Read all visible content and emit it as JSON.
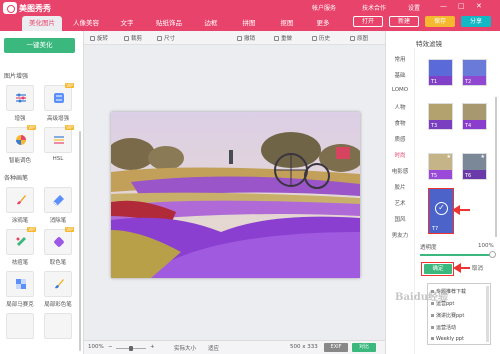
{
  "app": {
    "title": "美图秀秀"
  },
  "tabs": [
    {
      "label": "美化图片"
    },
    {
      "label": "人像美容"
    },
    {
      "label": "文字"
    },
    {
      "label": "贴纸饰品"
    },
    {
      "label": "边框"
    },
    {
      "label": "拼图"
    },
    {
      "label": "抠图"
    },
    {
      "label": "更多"
    }
  ],
  "top_links": {
    "account": "帐户服务",
    "tech": "技术合作",
    "settings": "设置"
  },
  "top_buttons": {
    "open": "打开",
    "new": "新建",
    "save": "保存",
    "share": "分享"
  },
  "toolbar": {
    "rotate": "旋转",
    "crop": "裁剪",
    "size": "尺寸",
    "undo": "撤销",
    "redo": "重做",
    "history": "历史",
    "original": "原图"
  },
  "left_panel": {
    "one_click": "一键美化",
    "section_enhance": "图片增强",
    "enhance_tools": [
      "增强",
      "高级增强",
      "智能调色",
      "HSL"
    ],
    "section_brush": "各种画笔",
    "brush_tools": [
      "涂鸦笔",
      "消除笔",
      "祛痘笔",
      "取色笔",
      "局部马赛克",
      "局部彩色笔"
    ],
    "vip_badge": "VIP"
  },
  "status": {
    "zoom": "100%",
    "minus": "−",
    "plus": "+",
    "actual": "实际大小",
    "fit": "适应",
    "dims": "500 x 333",
    "exif": "EXIF",
    "compare": "对比"
  },
  "right_panel": {
    "title": "特效滤镜",
    "categories": [
      "常用",
      "基础",
      "LOMO",
      "人物",
      "食物",
      "质感",
      "时尚",
      "电影感",
      "胶片",
      "艺术",
      "国风",
      "男友力"
    ],
    "active_category": "时尚",
    "thumbs": [
      "T1",
      "T2",
      "T3",
      "T4",
      "T5",
      "T6",
      "T7"
    ],
    "opacity_label": "透明度",
    "opacity_value": "100%",
    "opacity": 1.0,
    "ok": "确定",
    "cancel": "取消",
    "popup_items": [
      "专题推荐下载",
      "运营ppt",
      "演讲比赛ppt",
      "运营活动",
      "Weekly ppt"
    ]
  },
  "watermark": "Baidu经验",
  "colors": {
    "brand": "#e8436b",
    "green": "#3bb87d",
    "filter_blue": "#4c63c9"
  }
}
